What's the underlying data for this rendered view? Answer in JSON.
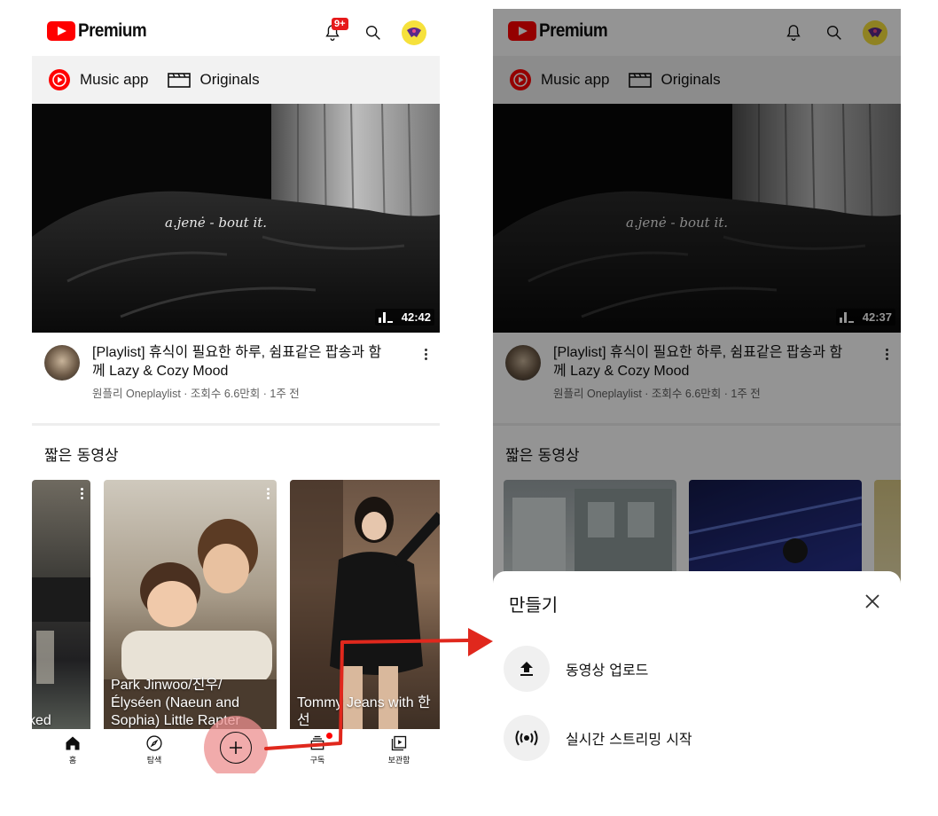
{
  "left": {
    "header": {
      "logo_text": "Premium",
      "notification_badge": "9+"
    },
    "chips": [
      {
        "label": "Music app"
      },
      {
        "label": "Originals"
      }
    ],
    "hero": {
      "overlay_text": "a.jenė - bout it.",
      "duration": "42:42"
    },
    "video": {
      "title": "[Playlist] 휴식이 필요한 하루, 쉼표같은 팝송과 함께 Lazy & Cozy Mood",
      "subtitle": "원플리 Oneplaylist · 조회수 6.6만회 · 1주 전"
    },
    "shorts_section_title": "짧은 동영상",
    "shorts": [
      {
        "title": "ked"
      },
      {
        "title": "Park Jinwoo/진우/ Élyséen (Naeun and Sophia) Little Rapter"
      },
      {
        "title": "Tommy Jeans  with 한선"
      }
    ],
    "nav": [
      {
        "label": "홈",
        "icon": "home-icon"
      },
      {
        "label": "탐색",
        "icon": "explore-compass-icon"
      },
      {
        "label": "",
        "icon": "create-plus-icon"
      },
      {
        "label": "구독",
        "icon": "subscriptions-icon"
      },
      {
        "label": "보관함",
        "icon": "library-icon"
      }
    ]
  },
  "right": {
    "header": {
      "logo_text": "Premium"
    },
    "chips": [
      {
        "label": "Music app"
      },
      {
        "label": "Originals"
      }
    ],
    "hero": {
      "overlay_text": "a.jenė - bout it.",
      "duration": "42:37"
    },
    "video": {
      "title": "[Playlist] 휴식이 필요한 하루, 쉼표같은 팝송과 함께 Lazy & Cozy Mood",
      "subtitle": "원플리 Oneplaylist · 조회수 6.6만회 · 1주 전"
    },
    "shorts_section_title": "짧은 동영상",
    "sheet": {
      "title": "만들기",
      "options": [
        {
          "label": "동영상 업로드",
          "icon": "upload-icon"
        },
        {
          "label": "실시간 스트리밍 시작",
          "icon": "live-stream-icon"
        }
      ]
    }
  },
  "colors": {
    "brand_red": "#ff0000",
    "highlight": "#ec8f8f",
    "annotation_arrow": "#e0281d"
  }
}
